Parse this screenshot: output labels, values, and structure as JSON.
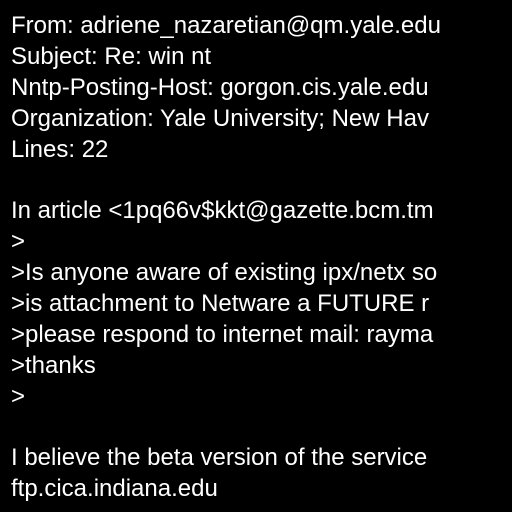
{
  "colors": {
    "background": "#000000",
    "text": "#ffffff"
  },
  "message": {
    "lines": [
      "From: adriene_nazaretian@qm.yale.edu",
      "Subject: Re: win nt",
      "Nntp-Posting-Host: gorgon.cis.yale.edu",
      "Organization: Yale University; New Hav",
      "Lines: 22",
      "",
      "In article <1pq66v$kkt@gazette.bcm.tm",
      ">",
      ">Is anyone aware of existing ipx/netx so",
      ">is attachment to Netware a FUTURE r",
      ">please respond to internet mail: rayma",
      ">thanks",
      ">",
      "",
      "I believe the beta version of the service",
      "ftp.cica.indiana.edu"
    ]
  }
}
